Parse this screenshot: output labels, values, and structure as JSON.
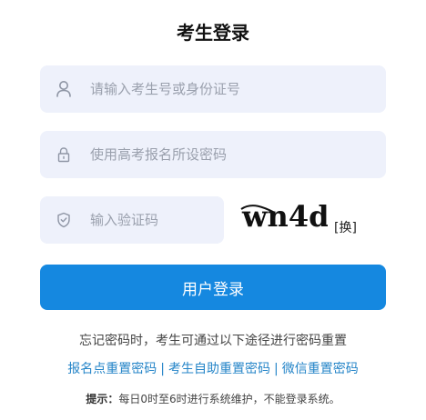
{
  "page": {
    "title": "考生登录"
  },
  "form": {
    "user_placeholder": "请输入考生号或身份证号",
    "password_placeholder": "使用高考报名所设密码",
    "captcha_placeholder": "输入验证码",
    "captcha_image_text": "wn4d",
    "refresh_label": "[换]",
    "login_label": "用户登录"
  },
  "recovery": {
    "hint": "忘记密码时，考生可通过以下途径进行密码重置",
    "links": [
      "报名点重置密码",
      "考生自助重置密码",
      "微信重置密码"
    ],
    "separator": "|"
  },
  "notice": {
    "label": "提示：",
    "text": "每日0时至6时进行系统维护，不能登录系统。"
  },
  "colors": {
    "accent": "#1588e0",
    "field_bg": "#eef1fb",
    "link": "#2585c8"
  },
  "icons": [
    "user-icon",
    "lock-icon",
    "shield-icon"
  ]
}
